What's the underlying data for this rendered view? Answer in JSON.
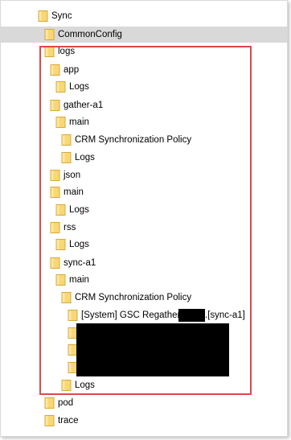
{
  "tree": {
    "items": [
      {
        "label": "Sync"
      },
      {
        "label": "CommonConfig"
      },
      {
        "label": "logs"
      },
      {
        "label": "app"
      },
      {
        "label": "Logs"
      },
      {
        "label": "gather-a1"
      },
      {
        "label": "main"
      },
      {
        "label": "CRM Synchronization Policy"
      },
      {
        "label": "Logs"
      },
      {
        "label": "json"
      },
      {
        "label": "main"
      },
      {
        "label": "Logs"
      },
      {
        "label": "rss"
      },
      {
        "label": "Logs"
      },
      {
        "label": "sync-a1"
      },
      {
        "label": "main"
      },
      {
        "label": "CRM Synchronization Policy"
      },
      {
        "label": "[System] GSC Regatherer",
        "suffix": ".[sync-a1]"
      },
      {
        "label": ""
      },
      {
        "label": ""
      },
      {
        "label": ""
      },
      {
        "label": "Logs"
      },
      {
        "label": "pod"
      },
      {
        "label": "trace"
      }
    ]
  },
  "colors": {
    "folder_fill": "#f8d775",
    "folder_edge": "#d9a83a",
    "selection": "#d9d9d9",
    "highlight": "#e04848",
    "redaction": "#000000"
  }
}
